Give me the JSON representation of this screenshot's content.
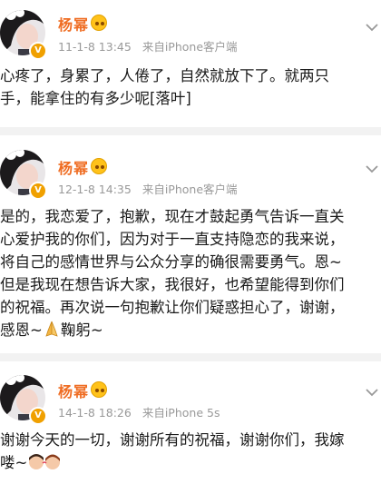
{
  "posts": [
    {
      "author": "杨幂",
      "time": "11-1-8 13:45",
      "source": "来自iPhone客户端",
      "lines": [
        "心疼了，身累了，人倦了，自然就放下了。就两只",
        "手，能拿住的有多少呢[落叶]"
      ]
    },
    {
      "author": "杨幂",
      "time": "12-1-8 14:35",
      "source": "来自iPhone客户端",
      "lines": [
        "是的，我恋爱了，抱歉，现在才鼓起勇气告诉一直关",
        "心爱护我的你们，因为对于一直支持隐恋的我来说，",
        "将自己的感情世界与公众分享的确很需要勇气。恩~",
        "但是我现在想告诉大家，我很好，也希望能得到你们",
        "的祝福。再次说一句抱歉让你们疑惑担心了，谢谢，",
        "感恩~",
        "鞠躬~"
      ]
    },
    {
      "author": "杨幂",
      "time": "14-1-8 18:26",
      "source": "来自iPhone 5s",
      "lines": [
        "谢谢今天的一切，谢谢所有的祝福，谢谢你们，我嫁",
        "喽~"
      ]
    }
  ],
  "icons": {
    "verified": "verified-v-badge",
    "crown": "gold-crown-badge",
    "menu": "chevron-down",
    "pray": "praying-hands-emoji",
    "couple": "kissing-couple-emoji"
  },
  "colors": {
    "name": "#ef6d23",
    "meta": "#999999",
    "divider": "#f2f2f2",
    "verified": "#f0a000"
  }
}
